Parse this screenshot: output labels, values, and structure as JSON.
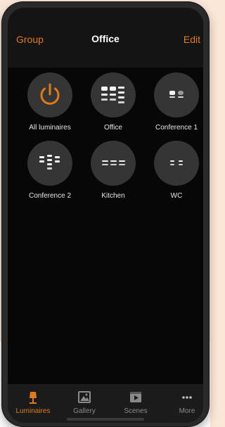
{
  "header": {
    "left_label": "Group",
    "title": "Office",
    "right_label": "Edit"
  },
  "groups": [
    {
      "label": "All luminaires",
      "icon": "power-icon"
    },
    {
      "label": "Office",
      "icon": "luminaire-cluster-icon"
    },
    {
      "label": "Conference 1",
      "icon": "luminaire-pair-icon"
    },
    {
      "label": "Conference 2",
      "icon": "luminaire-stack-icon"
    },
    {
      "label": "Kitchen",
      "icon": "luminaire-row-icon"
    },
    {
      "label": "WC",
      "icon": "luminaire-pair-small-icon"
    }
  ],
  "tabs": [
    {
      "label": "Luminaires",
      "icon": "lamp-icon",
      "active": true
    },
    {
      "label": "Gallery",
      "icon": "gallery-icon",
      "active": false
    },
    {
      "label": "Scenes",
      "icon": "scenes-icon",
      "active": false
    },
    {
      "label": "More",
      "icon": "more-icon",
      "active": false
    }
  ],
  "colors": {
    "accent": "#e07b1a",
    "background": "#070707",
    "tile": "#353535"
  }
}
